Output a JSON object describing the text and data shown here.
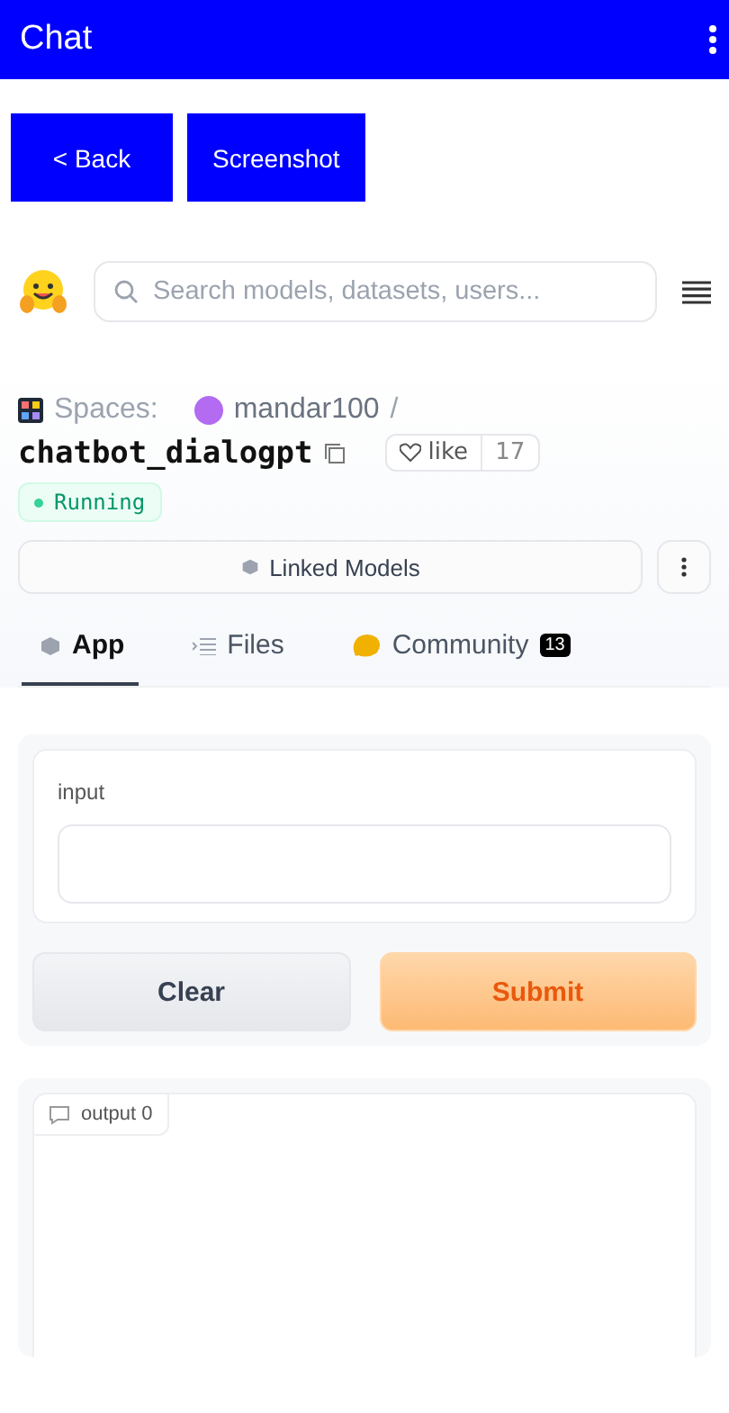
{
  "app_bar": {
    "title": "Chat"
  },
  "actions": [
    {
      "label": "< Back"
    },
    {
      "label": "Screenshot"
    }
  ],
  "site_header": {
    "search": {
      "placeholder": "Search models, datasets, users..."
    }
  },
  "space": {
    "section": "Spaces:",
    "owner": "mandar100",
    "separator": "/",
    "name": "chatbot_dialogpt",
    "like_label": "like",
    "like_count": "17",
    "status": "Running",
    "linked_models": "Linked Models"
  },
  "tabs": [
    {
      "label": "App",
      "kind": "app",
      "selected": true
    },
    {
      "label": "Files",
      "kind": "files",
      "selected": false
    },
    {
      "label": "Community",
      "kind": "community",
      "selected": false,
      "badge": "13"
    }
  ],
  "form": {
    "input_label": "input",
    "buttons": [
      {
        "label": "Clear",
        "kind": "secondary"
      },
      {
        "label": "Submit",
        "kind": "primary"
      }
    ],
    "output_label": "output 0"
  }
}
